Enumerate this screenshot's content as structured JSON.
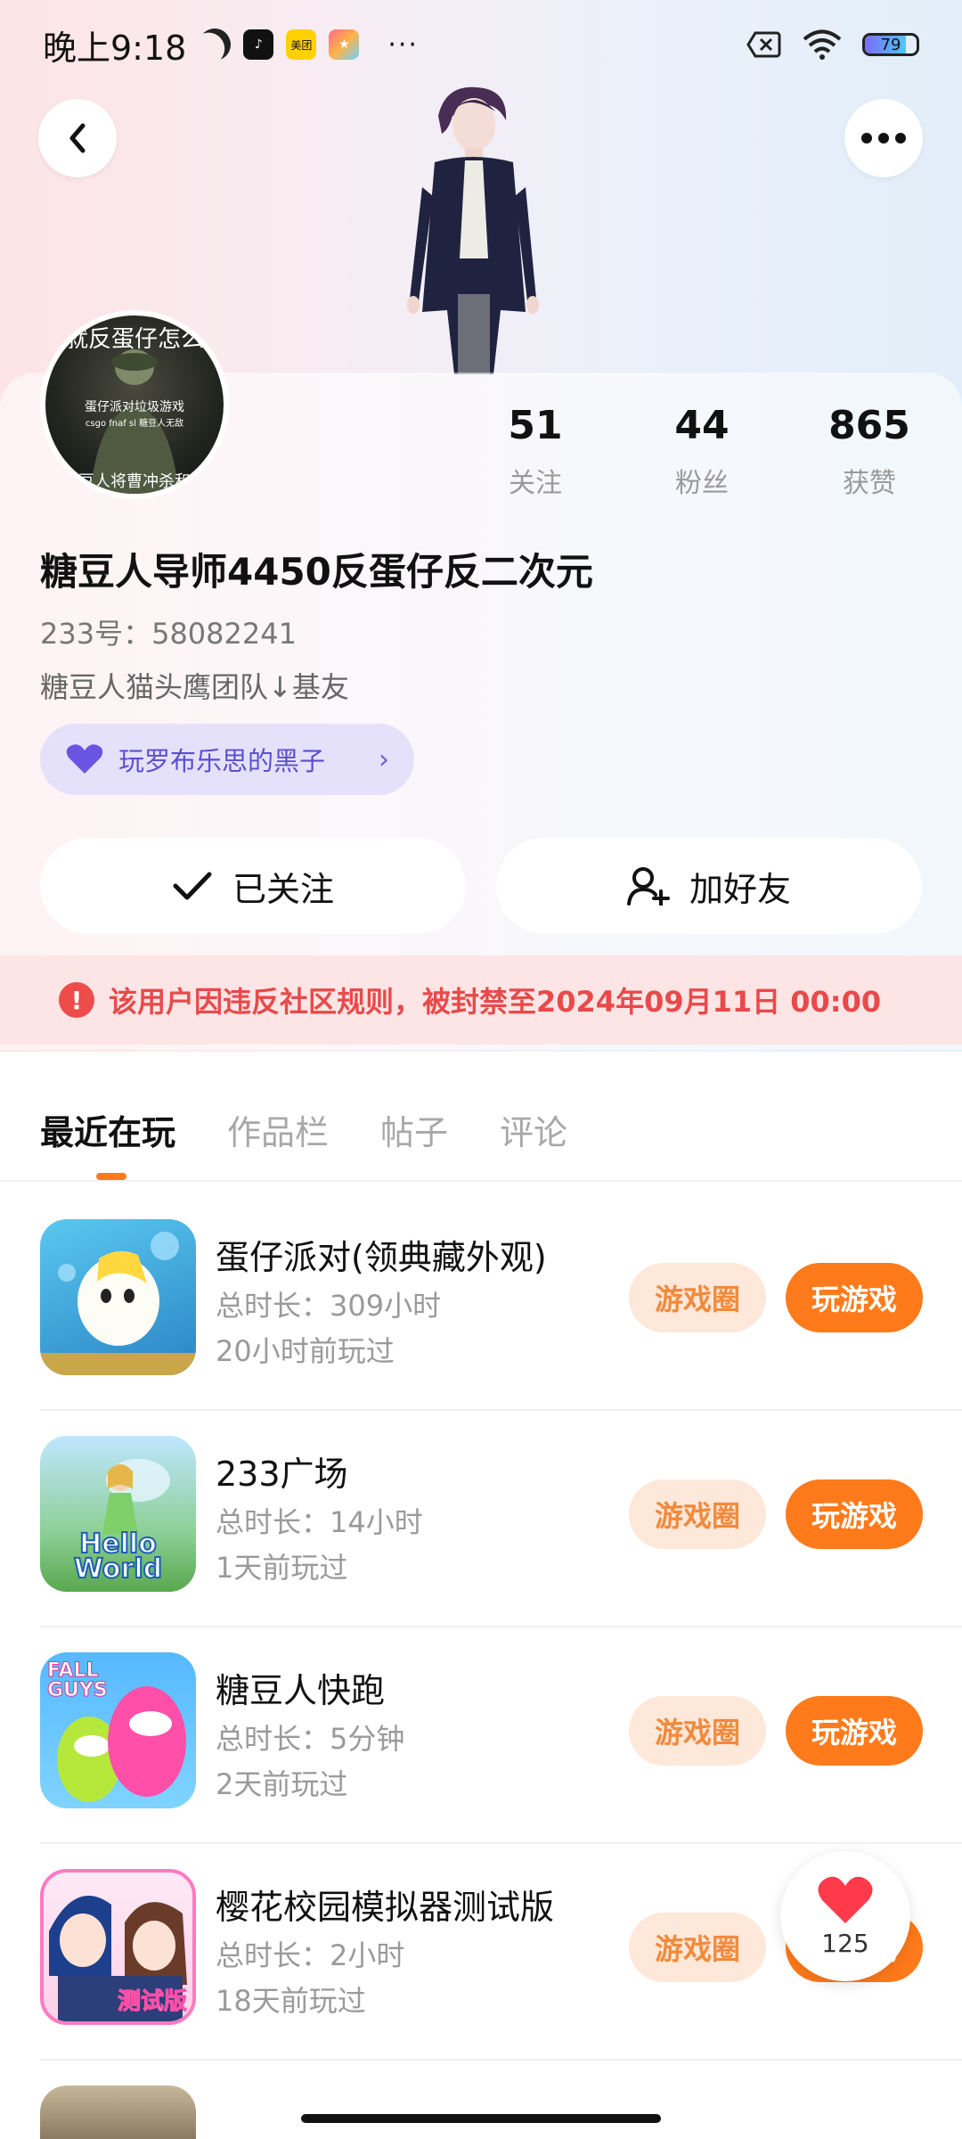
{
  "status_bar": {
    "time": "晚上9:18",
    "meituan_label": "美团",
    "battery_level": "79",
    "overflow_dots": "···"
  },
  "avatar": {
    "caption_top": "就反蛋仔怎么",
    "caption_mid": "蛋仔派对垃圾游戏",
    "caption_small": "csgo fnaf sl 糖豆人无敌",
    "caption_bottom": "糖豆人将曹冲杀和吧"
  },
  "stats": [
    {
      "value": "51",
      "label": "关注"
    },
    {
      "value": "44",
      "label": "粉丝"
    },
    {
      "value": "865",
      "label": "获赞"
    }
  ],
  "profile": {
    "nickname": "糖豆人导师4450反蛋仔反二次元",
    "uid": "233号：58082241",
    "bio": "糖豆人猫头鹰团队↓基友",
    "tag": "玩罗布乐思的黑子"
  },
  "actions": {
    "followed_label": "已关注",
    "add_friend_label": "加好友"
  },
  "ban_notice": "该用户因违反社区规则，被封禁至2024年09月11日 00:00",
  "tabs": [
    {
      "label": "最近在玩",
      "active": true
    },
    {
      "label": "作品栏",
      "active": false
    },
    {
      "label": "帖子",
      "active": false
    },
    {
      "label": "评论",
      "active": false
    }
  ],
  "games": [
    {
      "title": "蛋仔派对(领典藏外观)",
      "duration": "总时长：309小时",
      "last_played": "20小时前玩过",
      "circle_label": "游戏圈",
      "play_label": "玩游戏",
      "icon_text": ""
    },
    {
      "title": "233广场",
      "duration": "总时长：14小时",
      "last_played": "1天前玩过",
      "circle_label": "游戏圈",
      "play_label": "玩游戏",
      "icon_text": "Hello World"
    },
    {
      "title": "糖豆人快跑",
      "duration": "总时长：5分钟",
      "last_played": "2天前玩过",
      "circle_label": "游戏圈",
      "play_label": "玩游戏",
      "icon_text": "FALL GUYS"
    },
    {
      "title": "樱花校园模拟器测试版",
      "duration": "总时长：2小时",
      "last_played": "18天前玩过",
      "circle_label": "游戏圈",
      "play_label": "玩游戏",
      "icon_text": "测试版"
    }
  ],
  "like_float": {
    "count": "125"
  }
}
